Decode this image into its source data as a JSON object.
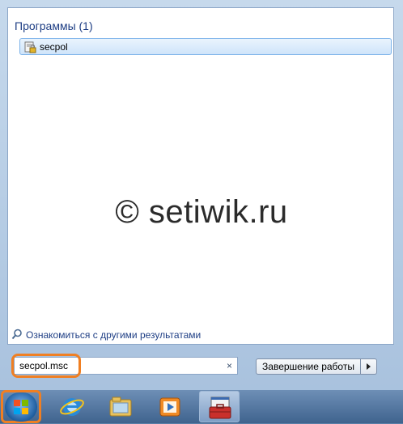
{
  "results": {
    "group_title": "Программы (1)",
    "items": [
      {
        "label": "secpol",
        "icon": "security-policy-icon"
      }
    ]
  },
  "watermark": "© setiwik.ru",
  "more_results": {
    "label": "Ознакомиться с другими результатами",
    "icon": "search-icon"
  },
  "search": {
    "value": "secpol.msc",
    "clear_symbol": "×"
  },
  "shutdown": {
    "label": "Завершение работы"
  },
  "taskbar": {
    "items": [
      {
        "name": "start-button",
        "icon": "windows-logo-icon"
      },
      {
        "name": "internet-explorer",
        "icon": "internet-explorer-icon"
      },
      {
        "name": "explorer",
        "icon": "folder-icon"
      },
      {
        "name": "media-player",
        "icon": "media-player-icon"
      },
      {
        "name": "active-app",
        "icon": "toolbox-icon"
      }
    ]
  },
  "colors": {
    "highlight": "#f07f22",
    "link": "#1e3e84"
  }
}
